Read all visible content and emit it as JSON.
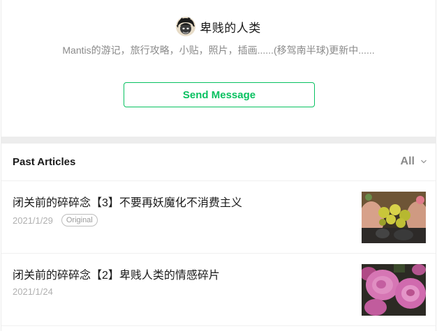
{
  "profile": {
    "avatar_icon": "avatar-icon",
    "name": "卑贱的人类",
    "bio": "Mantis的游记，旅行攻略，小贴，照片，插画......(移驾南半球)更新中......",
    "send_message_label": "Send Message"
  },
  "articles": {
    "header_title": "Past Articles",
    "filter_label": "All",
    "filter_icon": "chevron-down-icon",
    "items": [
      {
        "title": "闭关前的碎碎念【3】不要再妖魔化不消费主义",
        "date": "2021/1/29",
        "badge": "Original",
        "thumbnail": "lemons-in-hands-image"
      },
      {
        "title": "闭关前的碎碎念【2】卑贱人类的情感碎片",
        "date": "2021/1/24",
        "badge": "",
        "thumbnail": "pink-roses-image"
      }
    ]
  },
  "colors": {
    "accent_green": "#07c160",
    "muted_text": "#8a8a8a",
    "divider": "#ededed"
  }
}
